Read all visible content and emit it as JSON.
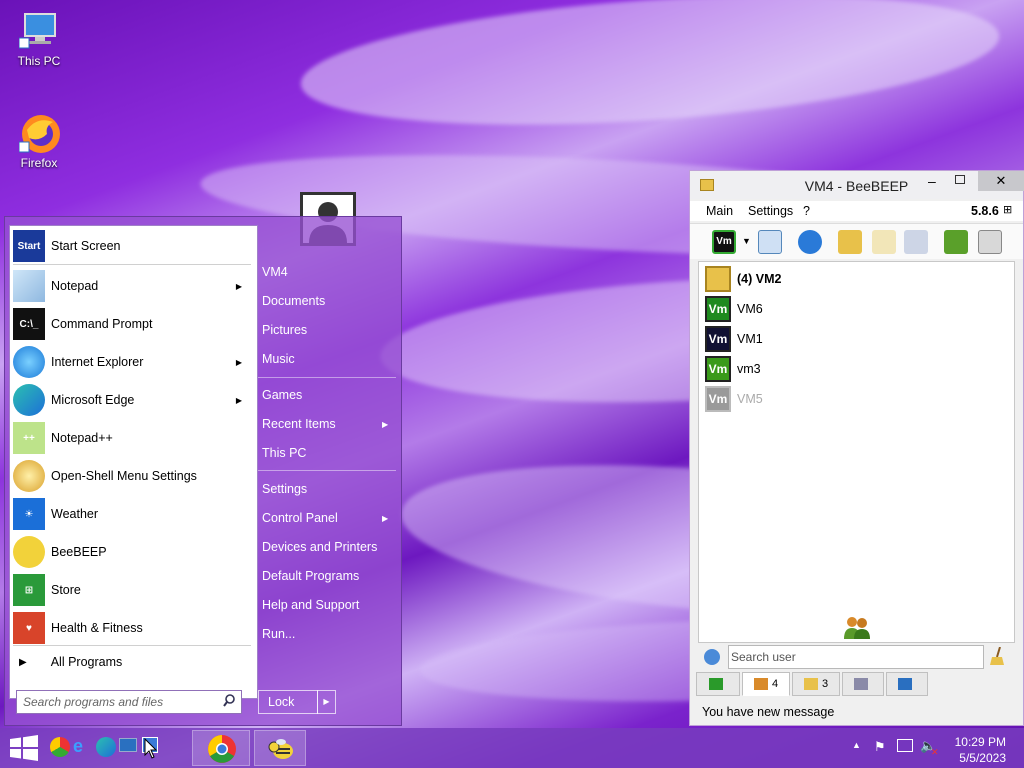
{
  "desktop": {
    "icons": [
      {
        "label": "This PC",
        "icon": "computer-icon"
      },
      {
        "label": "Firefox",
        "icon": "firefox-icon"
      }
    ]
  },
  "start_menu": {
    "programs": [
      {
        "label": "Start Screen",
        "icon": "start-screen-icon",
        "submenu": false
      },
      {
        "label": "Notepad",
        "icon": "notepad-icon",
        "submenu": true
      },
      {
        "label": "Command Prompt",
        "icon": "command-prompt-icon",
        "submenu": false
      },
      {
        "label": "Internet Explorer",
        "icon": "internet-explorer-icon",
        "submenu": true
      },
      {
        "label": "Microsoft Edge",
        "icon": "edge-icon",
        "submenu": true
      },
      {
        "label": "Notepad++",
        "icon": "notepadpp-icon",
        "submenu": false
      },
      {
        "label": "Open-Shell Menu Settings",
        "icon": "open-shell-icon",
        "submenu": false
      },
      {
        "label": "Weather",
        "icon": "weather-icon",
        "submenu": false
      },
      {
        "label": "BeeBEEP",
        "icon": "bee-icon",
        "submenu": false
      },
      {
        "label": "Store",
        "icon": "store-icon",
        "submenu": false
      },
      {
        "label": "Health & Fitness",
        "icon": "health-icon",
        "submenu": false
      }
    ],
    "all_programs": "All Programs",
    "search_placeholder": "Search programs and files",
    "right_items": [
      {
        "label": "VM4",
        "submenu": false
      },
      {
        "label": "Documents",
        "submenu": false
      },
      {
        "label": "Pictures",
        "submenu": false
      },
      {
        "label": "Music",
        "submenu": false
      },
      {
        "label": "Games",
        "submenu": false
      },
      {
        "label": "Recent Items",
        "submenu": true
      },
      {
        "label": "This PC",
        "submenu": false
      },
      {
        "label": "Settings",
        "submenu": false
      },
      {
        "label": "Control Panel",
        "submenu": true
      },
      {
        "label": "Devices and Printers",
        "submenu": false
      },
      {
        "label": "Default Programs",
        "submenu": false
      },
      {
        "label": "Help and Support",
        "submenu": false
      },
      {
        "label": "Run...",
        "submenu": false
      }
    ],
    "lock_label": "Lock"
  },
  "beebeep": {
    "title": "VM4 - BeeBEEP",
    "version": "5.8.6",
    "menu": [
      "Main",
      "Settings",
      "?"
    ],
    "toolbar_vm_label": "Vm",
    "users": [
      {
        "name": "(4) VM2",
        "bold": true,
        "avatar": "envelope",
        "color": "#e8c14a",
        "status": "message"
      },
      {
        "name": "VM6",
        "bold": false,
        "avatar": "Vm",
        "color": "#1f8a1f",
        "status": "online"
      },
      {
        "name": "VM1",
        "bold": false,
        "avatar": "Vm",
        "color": "#111133",
        "status": "online"
      },
      {
        "name": "vm3",
        "bold": false,
        "avatar": "Vm",
        "color": "#3a9a1a",
        "status": "online"
      },
      {
        "name": "VM5",
        "bold": false,
        "avatar": "Vm",
        "color": "#9a9a9a",
        "status": "offline"
      }
    ],
    "search_placeholder": "Search user",
    "tabs": [
      {
        "icon": "chat-icon",
        "count": ""
      },
      {
        "icon": "users-icon",
        "count": "4"
      },
      {
        "icon": "groups-icon",
        "count": "3"
      },
      {
        "icon": "network-icon",
        "count": ""
      },
      {
        "icon": "file-icon",
        "count": ""
      }
    ],
    "status": "You have new message"
  },
  "taskbar": {
    "time": "10:29 PM",
    "date": "5/5/2023"
  }
}
